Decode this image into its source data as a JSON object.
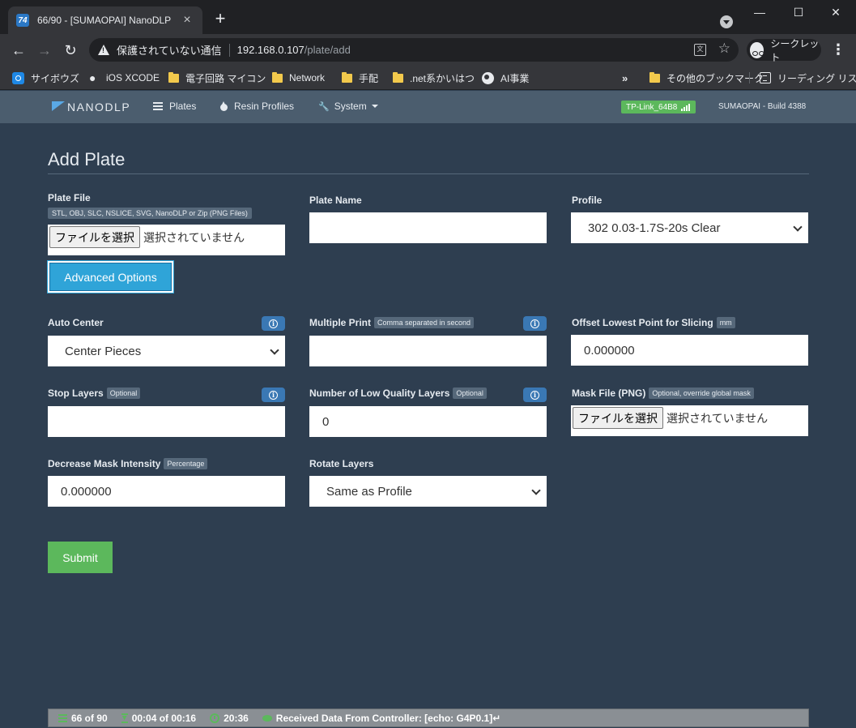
{
  "browser": {
    "tab": {
      "favicon": "74",
      "title": "66/90 - [SUMAOPAI] NanoDLP"
    },
    "window_controls": {
      "minimize": "—",
      "maximize": "☐",
      "close": "✕"
    },
    "omnibox": {
      "security": "保護されていない通信",
      "host": "192.168.0.107",
      "path": "/plate/add"
    },
    "incognito_label": "シークレット",
    "bookmarks": [
      {
        "label": "サイボウズ",
        "icon": "cybozu-icon"
      },
      {
        "label": "iOS XCODE",
        "icon": "apple-icon"
      },
      {
        "label": "電子回路 マイコン",
        "icon": "folder-icon"
      },
      {
        "label": "Network",
        "icon": "folder-icon"
      },
      {
        "label": "手配",
        "icon": "folder-icon"
      },
      {
        "label": ".net系かいはつ",
        "icon": "folder-icon"
      },
      {
        "label": "AI事業",
        "icon": "globe-icon"
      }
    ],
    "bookmarks_more": "»",
    "other_bookmarks": "その他のブックマーク",
    "reading_list": "リーディング リスト"
  },
  "app": {
    "brand": "NANODLP",
    "nav": {
      "plates": "Plates",
      "resin_profiles": "Resin Profiles",
      "system": "System"
    },
    "wifi": "TP-Link_64B8",
    "build": "SUMAOPAI - Build 4388"
  },
  "form": {
    "title": "Add Plate",
    "plate_file": {
      "label": "Plate File",
      "hint": "STL, OBJ, SLC, NSLICE, SVG, NanoDLP or Zip (PNG Files)",
      "button": "ファイルを選択",
      "status": "選択されていません"
    },
    "plate_name": {
      "label": "Plate Name",
      "value": ""
    },
    "profile": {
      "label": "Profile",
      "selected": "302 0.03-1.7S-20s Clear"
    },
    "advanced_button": "Advanced Options",
    "auto_center": {
      "label": "Auto Center",
      "selected": "Center Pieces"
    },
    "multiple_print": {
      "label": "Multiple Print",
      "tag": "Comma separated in second",
      "value": ""
    },
    "offset_lowest": {
      "label": "Offset Lowest Point for Slicing",
      "tag": "mm",
      "value": "0.000000"
    },
    "stop_layers": {
      "label": "Stop Layers",
      "tag": "Optional",
      "value": ""
    },
    "low_quality_layers": {
      "label": "Number of Low Quality Layers",
      "tag": "Optional",
      "value": "0"
    },
    "mask_file": {
      "label": "Mask File (PNG)",
      "tag": "Optional, override global mask",
      "button": "ファイルを選択",
      "status": "選択されていません"
    },
    "decrease_mask": {
      "label": "Decrease Mask Intensity",
      "tag": "Percentage",
      "value": "0.000000"
    },
    "rotate_layers": {
      "label": "Rotate Layers",
      "selected": "Same as Profile"
    },
    "submit": "Submit"
  },
  "status": {
    "layers": "66 of 90",
    "time": "00:04 of 00:16",
    "clock": "20:36",
    "message": "Received Data From Controller: [echo: G4P0.1]↵"
  }
}
